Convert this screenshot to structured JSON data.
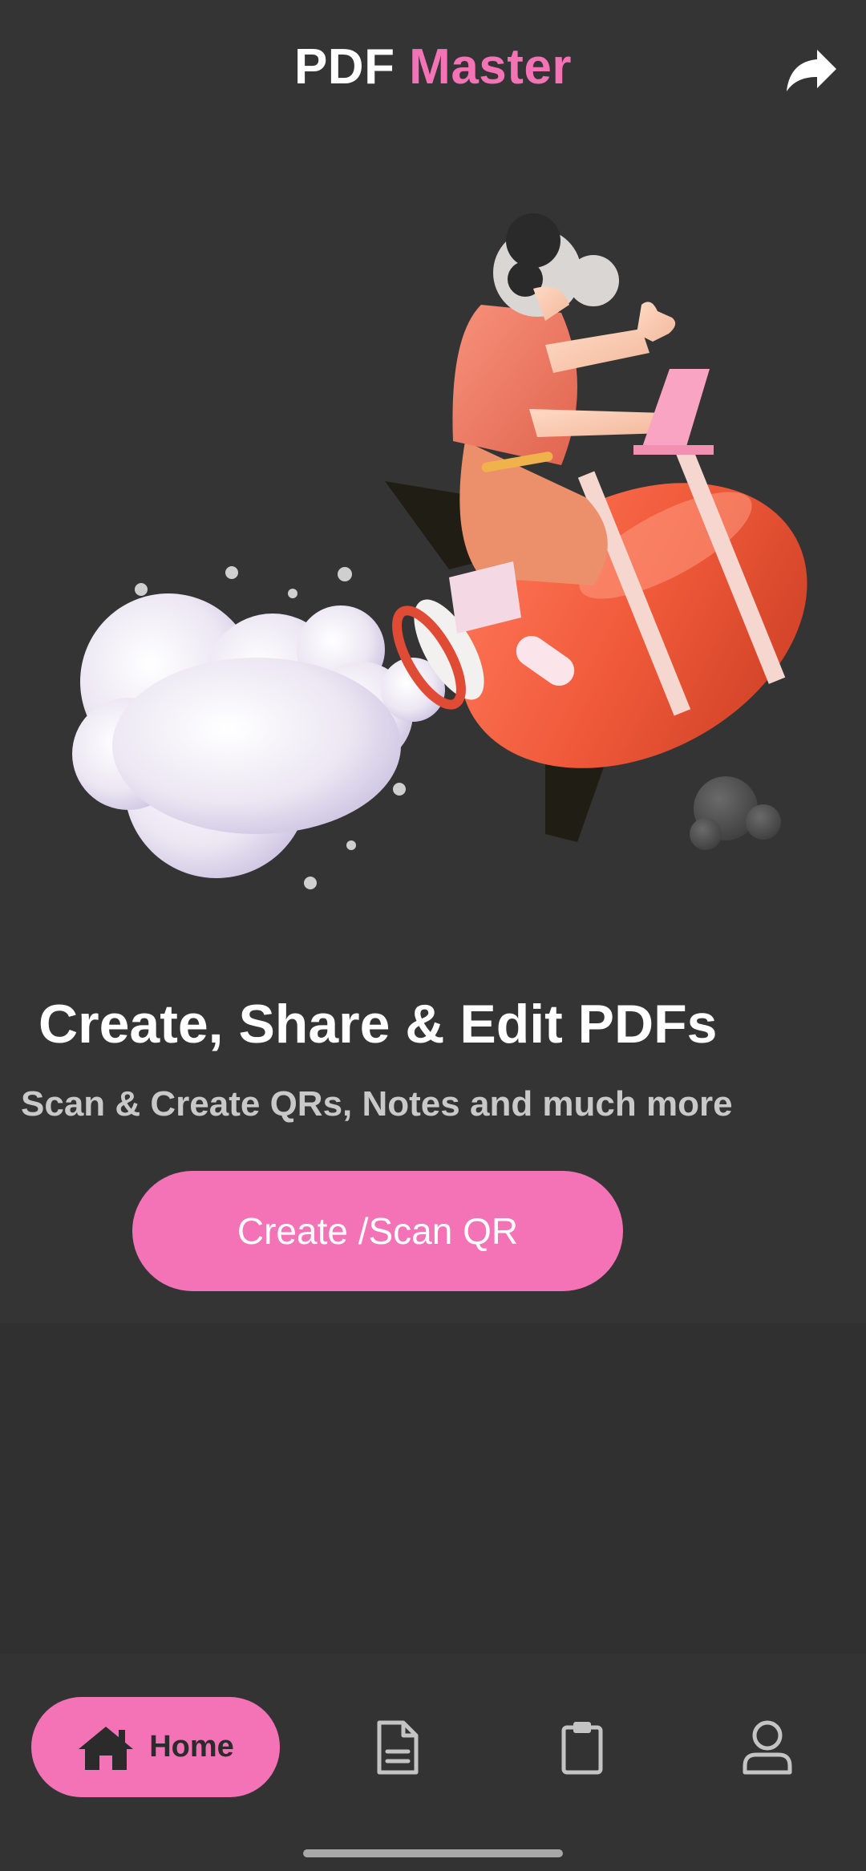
{
  "app": {
    "title_part1": "PDF",
    "title_part2": "Master"
  },
  "header": {
    "share_icon": "share-forward-icon"
  },
  "hero": {
    "illustration": "rocket-girl-illustration"
  },
  "main": {
    "headline": "Create, Share & Edit PDFs",
    "subheadline": "Scan & Create QRs, Notes and much more",
    "cta_label": "Create /Scan QR"
  },
  "bottom_nav": {
    "items": [
      {
        "label": "Home",
        "icon": "home-icon",
        "active": true
      },
      {
        "label": "",
        "icon": "document-icon",
        "active": false
      },
      {
        "label": "",
        "icon": "clipboard-icon",
        "active": false
      },
      {
        "label": "",
        "icon": "user-icon",
        "active": false
      }
    ]
  },
  "colors": {
    "background": "#343434",
    "accent": "#f472b6",
    "text": "#ffffff",
    "muted_text": "#c9c9c9"
  }
}
